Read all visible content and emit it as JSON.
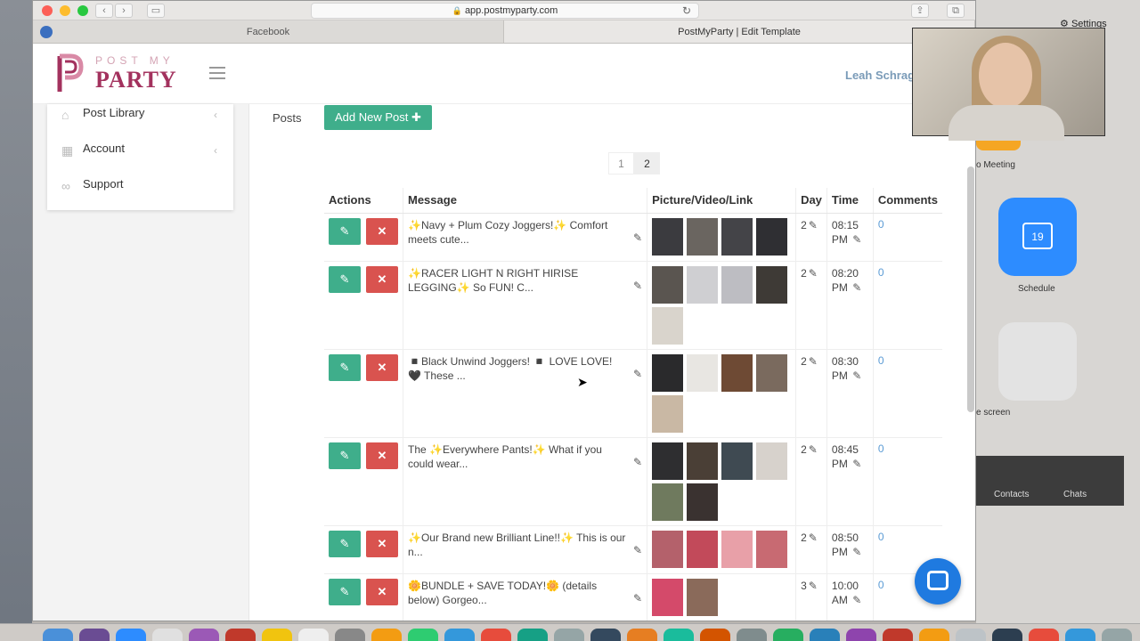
{
  "browser": {
    "url": "app.postmyparty.com",
    "tabs": [
      {
        "label": "Facebook",
        "active": false
      },
      {
        "label": "PostMyParty | Edit Template",
        "active": true
      }
    ]
  },
  "header": {
    "logo_top": "POST MY",
    "logo_main": "PARTY",
    "user_name": "Leah Schrage"
  },
  "sidebar": {
    "items": [
      {
        "label": "Post Library",
        "icon": "tags-icon"
      },
      {
        "label": "Account",
        "icon": "calendar-icon"
      },
      {
        "label": "Support",
        "icon": "link-icon"
      }
    ]
  },
  "main": {
    "posts_label": "Posts",
    "add_button": "Add New Post ✚",
    "pages": [
      "1",
      "2"
    ],
    "current_page": "2",
    "columns": [
      "Actions",
      "Message",
      "Picture/Video/Link",
      "Day",
      "Time",
      "Comments"
    ],
    "rows": [
      {
        "message": "✨Navy + Plum Cozy Joggers!✨ Comfort meets cute...",
        "day": "2",
        "time_a": "08:15",
        "time_b": "PM",
        "comments": "0",
        "thumbs": [
          "#3b3b3f",
          "#6a6560",
          "#444448",
          "#2f2f33"
        ]
      },
      {
        "message": "✨RACER LIGHT N RIGHT HIRISE LEGGING✨ So FUN! C...",
        "day": "2",
        "time_a": "08:20",
        "time_b": "PM",
        "comments": "0",
        "thumbs": [
          "#5a5550",
          "#cfcfd2",
          "#bdbdc2",
          "#3e3a36",
          "#d9d4cc"
        ]
      },
      {
        "message": "◾Black Unwind Joggers! ◾ LOVE LOVE! 🖤 These ...",
        "day": "2",
        "time_a": "08:30",
        "time_b": "PM",
        "comments": "0",
        "thumbs": [
          "#2a2a2c",
          "#e8e6e2",
          "#6e4a34",
          "#7a6a5e",
          "#c9b8a4"
        ]
      },
      {
        "message": "The ✨Everywhere Pants!✨ What if you could wear...",
        "day": "2",
        "time_a": "08:45",
        "time_b": "PM",
        "comments": "0",
        "thumbs": [
          "#2e2e30",
          "#4a3f36",
          "#3f4a52",
          "#d7d2cc",
          "#6f7a5e",
          "#3a3230"
        ]
      },
      {
        "message": "✨Our Brand new Brilliant Line!!✨ This is our n...",
        "day": "2",
        "time_a": "08:50",
        "time_b": "PM",
        "comments": "0",
        "thumbs": [
          "#b4616b",
          "#c24a5a",
          "#e8a0a8",
          "#c86a72"
        ]
      },
      {
        "message": "🌼BUNDLE + SAVE TODAY!🌼 (details below) Gorgeo...",
        "day": "3",
        "time_a": "10:00",
        "time_b": "AM",
        "comments": "0",
        "thumbs": [
          "#d44a6a",
          "#8a6a5a"
        ]
      }
    ]
  },
  "zoom": {
    "settings": "Settings",
    "meeting": "o Meeting",
    "schedule": "Schedule",
    "calendar_day": "19",
    "share_screen": "e screen",
    "contacts": "Contacts",
    "chats": "Chats"
  },
  "colors": {
    "brand": "#a3325e",
    "primary_button": "#3fae8b",
    "danger_button": "#d9534f",
    "comment_link": "#5b9bd5"
  }
}
